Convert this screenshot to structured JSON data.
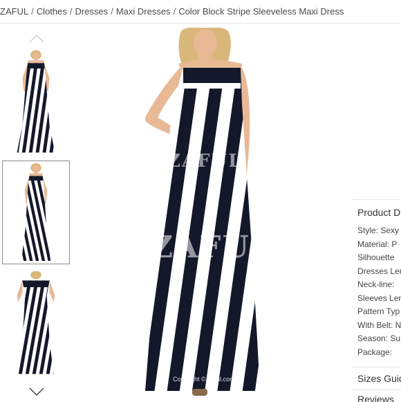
{
  "breadcrumb": {
    "items": [
      "ZAFUL",
      "Clothes",
      "Dresses",
      "Maxi Dresses",
      "Color Block Stripe Sleeveless Maxi Dress"
    ],
    "separator": "/"
  },
  "gallery": {
    "thumbnails": [
      {
        "alt": "dress-front-view",
        "selected": false
      },
      {
        "alt": "dress-alt-view",
        "selected": true
      },
      {
        "alt": "dress-off-shoulder-view",
        "selected": false
      }
    ],
    "up_icon": "chevron-up-icon",
    "down_icon": "chevron-down-icon"
  },
  "main_image": {
    "watermark_top": "ZAFUL",
    "watermark_center": "ZAFUL",
    "copyright": "Copyright © Zaful.com"
  },
  "details": {
    "title": "Product D",
    "specs": [
      "Style: Sexy",
      "Material: P",
      "Silhouette",
      "Dresses Ler",
      "Neck-line:",
      "Sleeves Len",
      "Pattern Typ",
      "With Belt: N",
      "Season: Su",
      "Package:"
    ],
    "sizes_title": "Sizes Guid",
    "reviews_title": "Reviews"
  },
  "colors": {
    "stripe_dark": "#14182b",
    "stripe_light": "#ffffff",
    "skin": "#e9b996",
    "hair": "#d9b77a"
  }
}
